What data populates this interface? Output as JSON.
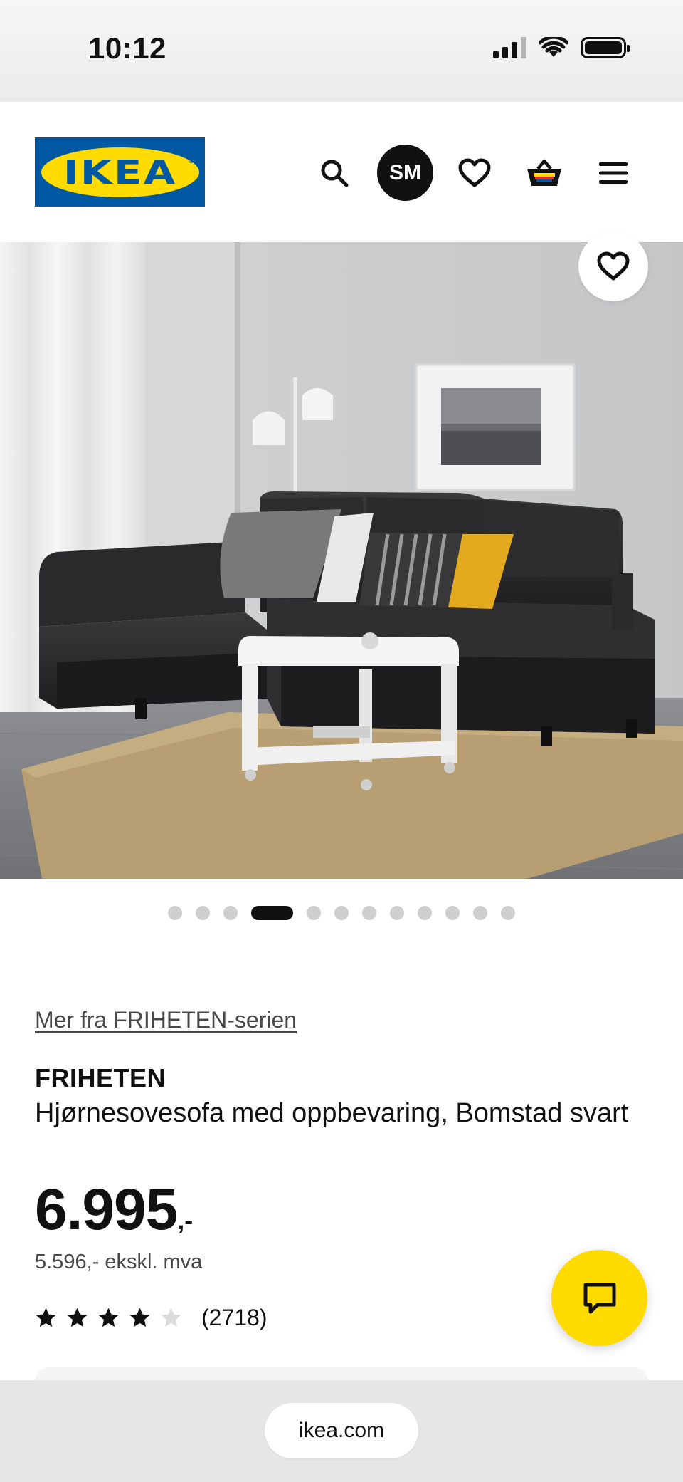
{
  "status_bar": {
    "time": "10:12"
  },
  "header": {
    "logo_text": "IKEA",
    "logo_reg": "®",
    "avatar_initials": "SM",
    "icons": [
      "search-icon",
      "heart-icon",
      "basket-icon",
      "menu-icon"
    ],
    "colors": {
      "logo_blue": "#0058a3",
      "logo_yellow": "#ffdb00"
    }
  },
  "gallery": {
    "image_count": 12,
    "active_index": 3
  },
  "product": {
    "series_link": "Mer fra FRIHETEN-serien",
    "name": "FRIHETEN",
    "description": "Hjørnesovesofa med oppbevaring, Bomstad svart",
    "price_main": "6.995",
    "price_suffix": ",-",
    "price_ex_vat": "5.596,- ekskl. mva",
    "rating": {
      "stars": 4,
      "max": 5,
      "count": "(2718)"
    }
  },
  "chat": {
    "icon": "chat-icon",
    "color": "#ffdb00"
  },
  "browser": {
    "url": "ikea.com"
  }
}
